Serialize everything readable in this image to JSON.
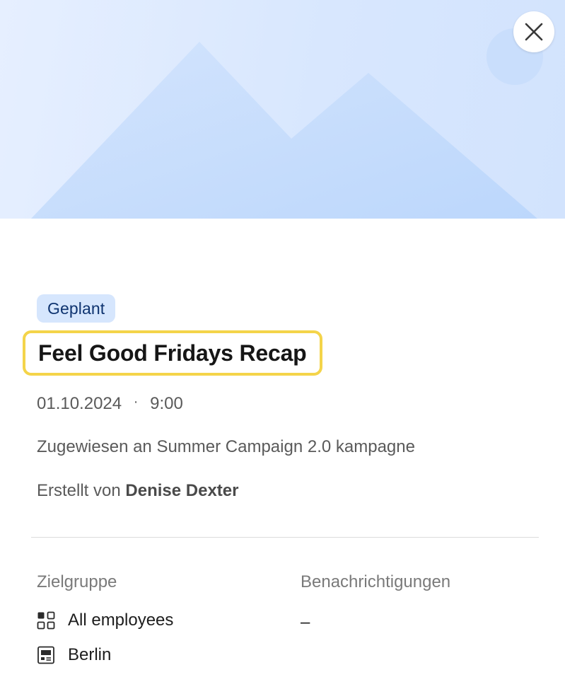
{
  "header": {
    "image_alt": "placeholder-image",
    "close_label": "Close"
  },
  "post": {
    "status": "Geplant",
    "title": "Feel Good Fridays Recap",
    "date": "01.10.2024",
    "separator": "·",
    "time": "9:00",
    "assigned_text": "Zugewiesen an Summer Campaign 2.0 kampagne",
    "created_prefix": "Erstellt von",
    "created_by": "Denise Dexter"
  },
  "details": {
    "audience_label": "Zielgruppe",
    "notifications_label": "Benachrichtigungen",
    "audience_items": [
      {
        "icon": "grid-icon",
        "label": "All employees"
      },
      {
        "icon": "location-card-icon",
        "label": "Berlin"
      }
    ],
    "notifications_value": "–"
  },
  "colors": {
    "badge_bg": "#d6e6fd",
    "badge_text": "#0f3470",
    "highlight_border": "#f4d44a",
    "hero_mountain": "#c3dbfc"
  }
}
